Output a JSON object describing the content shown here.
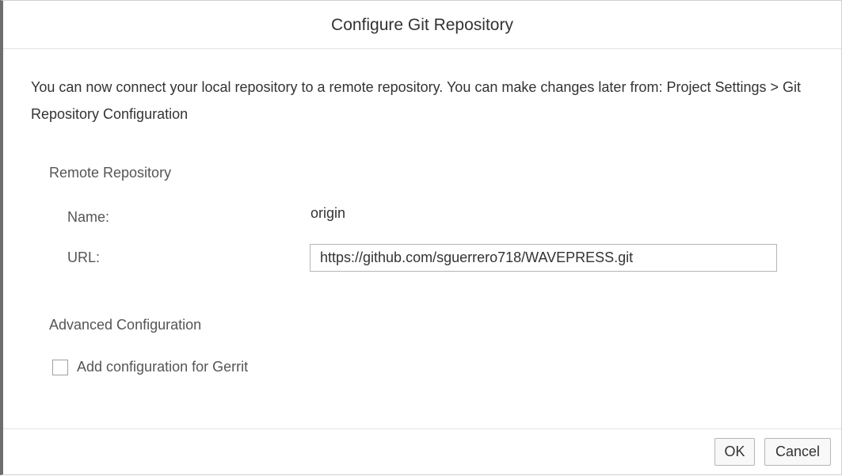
{
  "dialog": {
    "title": "Configure Git Repository",
    "intro": "You can now connect your local repository to a remote repository. You can make changes later from: Project Settings > Git Repository Configuration"
  },
  "remote": {
    "section_label": "Remote Repository",
    "name_label": "Name:",
    "name_value": "origin",
    "url_label": "URL:",
    "url_value": "https://github.com/sguerrero718/WAVEPRESS.git"
  },
  "advanced": {
    "section_label": "Advanced Configuration",
    "gerrit_label": "Add configuration for Gerrit",
    "gerrit_checked": false
  },
  "footer": {
    "ok_label": "OK",
    "cancel_label": "Cancel"
  }
}
